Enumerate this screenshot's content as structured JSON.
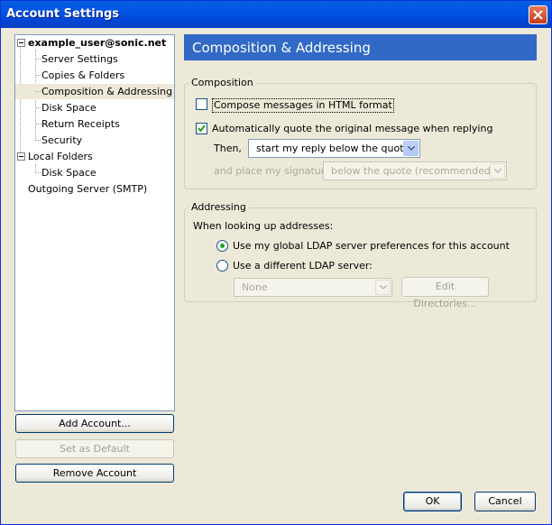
{
  "window": {
    "title": "Account Settings"
  },
  "tree": {
    "account": "example_user@sonic.net",
    "account_items": [
      "Server Settings",
      "Copies & Folders",
      "Composition & Addressing",
      "Disk Space",
      "Return Receipts",
      "Security"
    ],
    "local_folders": "Local Folders",
    "local_items": [
      "Disk Space"
    ],
    "outgoing": "Outgoing Server (SMTP)",
    "selected": "Composition & Addressing"
  },
  "left_buttons": {
    "add": "Add Account...",
    "set_default": "Set as Default",
    "remove": "Remove Account"
  },
  "panel": {
    "title": "Composition & Addressing",
    "composition": {
      "legend": "Composition",
      "html_label": "Compose messages in HTML format",
      "html_checked": false,
      "quote_label": "Automatically quote the original message when replying",
      "quote_checked": true,
      "then_label": "Then,",
      "then_value": "start my reply below the quote",
      "signature_label": "and place my signature",
      "signature_value": "below the quote (recommended)"
    },
    "addressing": {
      "legend": "Addressing",
      "intro": "When looking up addresses:",
      "global_label": "Use my global LDAP server preferences for this account",
      "different_label": "Use a different LDAP server:",
      "selected_option": "global",
      "server_value": "None",
      "edit_dirs": "Edit Directories..."
    }
  },
  "footer": {
    "ok": "OK",
    "cancel": "Cancel"
  },
  "colors": {
    "title_bar": "#0055e5",
    "header_bg": "#3169c6",
    "dialog_bg": "#ece9d8"
  }
}
